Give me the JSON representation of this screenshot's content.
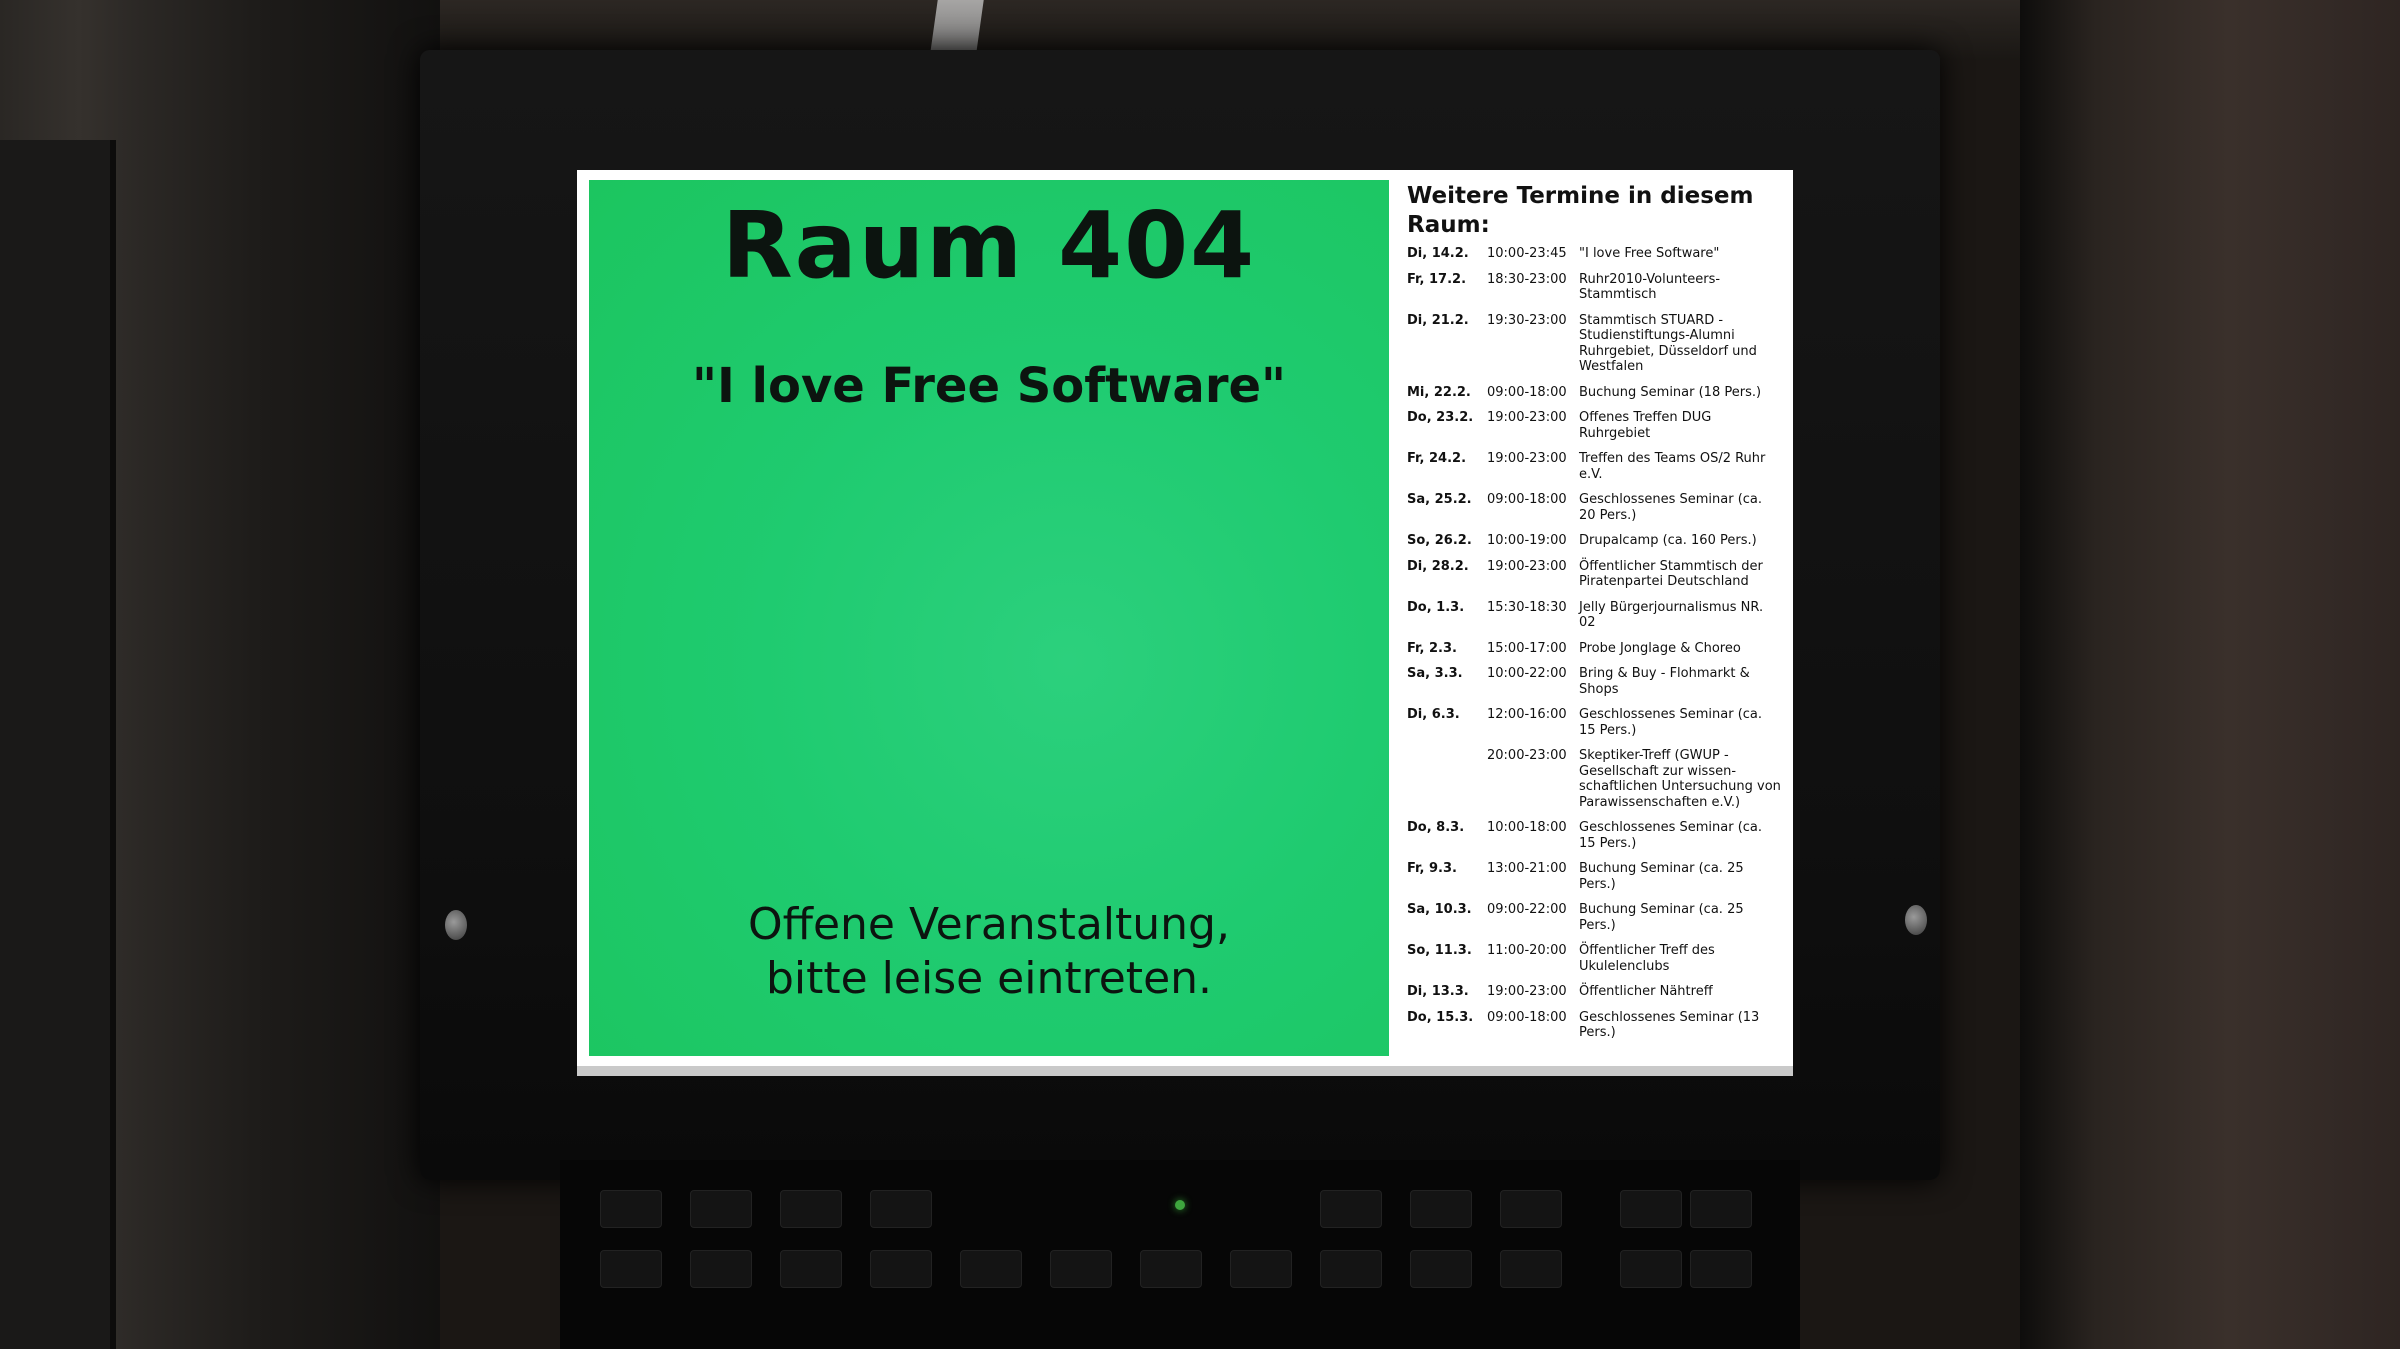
{
  "screen": {
    "room_title": "Raum 404",
    "current_event": "\"I love Free Software\"",
    "notice_line1": "Offene Veranstaltung,",
    "notice_line2": "bitte leise eintreten.",
    "accent_color": "#1fcb70"
  },
  "schedule": {
    "heading": "Weitere Termine in diesem Raum:",
    "entries": [
      {
        "date": "Di, 14.2.",
        "time": "10:00-23:45",
        "event": "\"I love Free Software\""
      },
      {
        "date": "Fr, 17.2.",
        "time": "18:30-23:00",
        "event": "Ruhr2010-Volunteers-Stammtisch"
      },
      {
        "date": "Di, 21.2.",
        "time": "19:30-23:00",
        "event": "Stammtisch STUARD - Studienstiftungs-Alumni Ruhrgebiet, Düsseldorf und Westfalen"
      },
      {
        "date": "Mi, 22.2.",
        "time": "09:00-18:00",
        "event": "Buchung Seminar (18 Pers.)"
      },
      {
        "date": "Do, 23.2.",
        "time": "19:00-23:00",
        "event": "Offenes Treffen DUG Ruhrgebiet"
      },
      {
        "date": "Fr, 24.2.",
        "time": "19:00-23:00",
        "event": "Treffen des Teams OS/2 Ruhr e.V."
      },
      {
        "date": "Sa, 25.2.",
        "time": "09:00-18:00",
        "event": "Geschlossenes Seminar (ca. 20 Pers.)"
      },
      {
        "date": "So, 26.2.",
        "time": "10:00-19:00",
        "event": "Drupalcamp (ca. 160 Pers.)"
      },
      {
        "date": "Di, 28.2.",
        "time": "19:00-23:00",
        "event": "Öffentlicher Stammtisch der Piratenpartei Deutschland"
      },
      {
        "date": "Do, 1.3.",
        "time": "15:30-18:30",
        "event": "Jelly Bürgerjournalismus NR. 02"
      },
      {
        "date": "Fr, 2.3.",
        "time": "15:00-17:00",
        "event": "Probe Jonglage & Choreo"
      },
      {
        "date": "Sa, 3.3.",
        "time": "10:00-22:00",
        "event": "Bring & Buy - Flohmarkt & Shops"
      },
      {
        "date": "Di, 6.3.",
        "time": "12:00-16:00",
        "event": "Geschlossenes Seminar (ca. 15 Pers.)"
      },
      {
        "date": "",
        "time": "20:00-23:00",
        "event": "Skeptiker-Treff (GWUP - Gesellschaft zur wissen-schaftlichen Untersuchung von Parawissenschaften e.V.)"
      },
      {
        "date": "Do, 8.3.",
        "time": "10:00-18:00",
        "event": "Geschlossenes Seminar (ca. 15 Pers.)"
      },
      {
        "date": "Fr, 9.3.",
        "time": "13:00-21:00",
        "event": "Buchung Seminar (ca. 25 Pers.)"
      },
      {
        "date": "Sa, 10.3.",
        "time": "09:00-22:00",
        "event": "Buchung Seminar (ca. 25 Pers.)"
      },
      {
        "date": "So, 11.3.",
        "time": "11:00-20:00",
        "event": "Öffentlicher Treff des Ukulelenclubs"
      },
      {
        "date": "Di, 13.3.",
        "time": "19:00-23:00",
        "event": "Öffentlicher Nähtreff"
      },
      {
        "date": "Do, 15.3.",
        "time": "09:00-18:00",
        "event": "Geschlossenes Seminar (13 Pers.)"
      }
    ]
  }
}
